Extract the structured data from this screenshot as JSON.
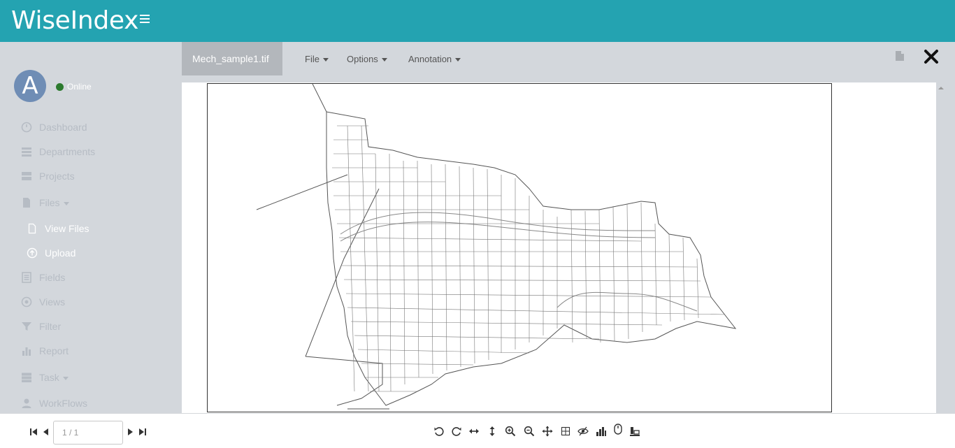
{
  "app": {
    "title": "WiseIndex",
    "menu_icon": "hamburger-icon",
    "accent_color": "#24a3b1"
  },
  "user": {
    "avatar_letter": "A",
    "status": "Online",
    "status_color": "#2c7a2e"
  },
  "sidebar": {
    "items": [
      {
        "label": "Dashboard",
        "icon": "dashboard-icon"
      },
      {
        "label": "Departments",
        "icon": "list-icon"
      },
      {
        "label": "Projects",
        "icon": "server-icon"
      },
      {
        "label": "Files",
        "icon": "file-icon",
        "has_caret": true
      },
      {
        "label": "View Files",
        "icon": "file-outline-icon",
        "sub": true
      },
      {
        "label": "Upload",
        "icon": "upload-icon",
        "sub": true
      },
      {
        "label": "Fields",
        "icon": "list-alt-icon"
      },
      {
        "label": "Views",
        "icon": "target-icon"
      },
      {
        "label": "Filter",
        "icon": "filter-icon"
      },
      {
        "label": "Report",
        "icon": "bar-chart-icon"
      },
      {
        "label": "Task",
        "icon": "tasks-icon",
        "has_caret": true
      },
      {
        "label": "WorkFlows",
        "icon": "user-icon"
      }
    ]
  },
  "viewer": {
    "file_tab": "Mech_sample1.tif",
    "menus": [
      {
        "label": "File"
      },
      {
        "label": "Options"
      },
      {
        "label": "Annotation"
      }
    ]
  },
  "pagination": {
    "value": "1 / 1"
  },
  "toolbar": {
    "tools": [
      "rotate-left-icon",
      "rotate-right-icon",
      "fit-width-icon",
      "fit-height-icon",
      "zoom-in-icon",
      "zoom-out-icon",
      "pan-icon",
      "grid-icon",
      "hide-annotations-icon",
      "histogram-icon",
      "mouse-select-icon",
      "stamp-icon"
    ]
  }
}
